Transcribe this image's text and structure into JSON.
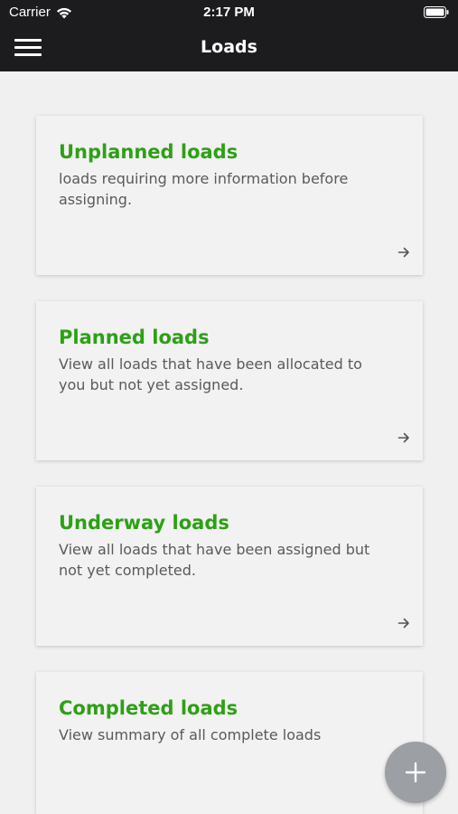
{
  "status_bar": {
    "carrier": "Carrier",
    "time": "2:17 PM",
    "wifi_icon": "wifi-icon",
    "battery_icon": "battery-icon"
  },
  "nav": {
    "title": "Loads",
    "menu_icon": "hamburger-menu-icon"
  },
  "cards": [
    {
      "title": "Unplanned loads",
      "description": "loads requiring more information before assigning.",
      "arrow_icon": "arrow-right-icon"
    },
    {
      "title": "Planned loads",
      "description": "View all loads that have been allocated to you but not yet assigned.",
      "arrow_icon": "arrow-right-icon"
    },
    {
      "title": "Underway loads",
      "description": "View all loads that have been assigned but not yet completed.",
      "arrow_icon": "arrow-right-icon"
    },
    {
      "title": "Completed loads",
      "description": "View summary of all complete loads",
      "arrow_icon": "arrow-right-icon"
    }
  ],
  "fab": {
    "icon": "plus-icon"
  },
  "colors": {
    "header_bg": "#1c1c1e",
    "card_title": "#2ea016",
    "page_bg": "#f0f0f0",
    "fab_bg": "#9c9fa4"
  }
}
